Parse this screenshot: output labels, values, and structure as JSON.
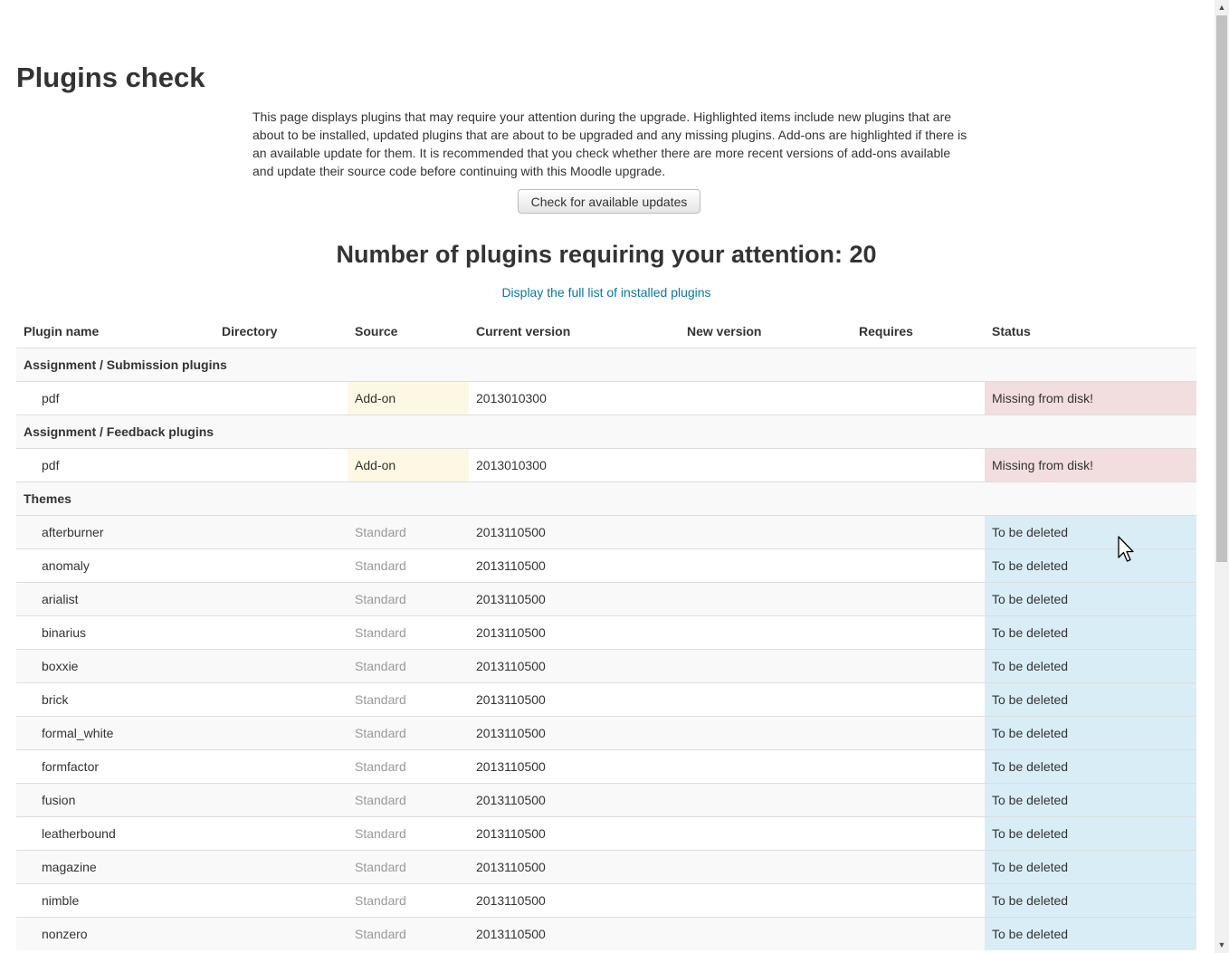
{
  "page": {
    "title": "Plugins check",
    "intro": "This page displays plugins that may require your attention during the upgrade. Highlighted items include new plugins that are about to be installed, updated plugins that are about to be upgraded and any missing plugins. Add-ons are highlighted if there is an available update for them. It is recommended that you check whether there are more recent versions of add-ons available and update their source code before continuing with this Moodle upgrade.",
    "check_button": "Check for available updates",
    "summary": "Number of plugins requiring your attention: 20",
    "full_list_link": "Display the full list of installed plugins"
  },
  "table": {
    "headers": [
      "Plugin name",
      "Directory",
      "Source",
      "Current version",
      "New version",
      "Requires",
      "Status"
    ],
    "rows": [
      {
        "type": "group",
        "name": "Assignment / Submission plugins"
      },
      {
        "type": "plugin",
        "name": "pdf",
        "source": "Add-on",
        "current": "2013010300",
        "status": "Missing from disk!"
      },
      {
        "type": "group",
        "name": "Assignment / Feedback plugins"
      },
      {
        "type": "plugin",
        "name": "pdf",
        "source": "Add-on",
        "current": "2013010300",
        "status": "Missing from disk!"
      },
      {
        "type": "group",
        "name": "Themes"
      },
      {
        "type": "plugin",
        "name": "afterburner",
        "source": "Standard",
        "current": "2013110500",
        "status": "To be deleted"
      },
      {
        "type": "plugin",
        "name": "anomaly",
        "source": "Standard",
        "current": "2013110500",
        "status": "To be deleted"
      },
      {
        "type": "plugin",
        "name": "arialist",
        "source": "Standard",
        "current": "2013110500",
        "status": "To be deleted"
      },
      {
        "type": "plugin",
        "name": "binarius",
        "source": "Standard",
        "current": "2013110500",
        "status": "To be deleted"
      },
      {
        "type": "plugin",
        "name": "boxxie",
        "source": "Standard",
        "current": "2013110500",
        "status": "To be deleted"
      },
      {
        "type": "plugin",
        "name": "brick",
        "source": "Standard",
        "current": "2013110500",
        "status": "To be deleted"
      },
      {
        "type": "plugin",
        "name": "formal_white",
        "source": "Standard",
        "current": "2013110500",
        "status": "To be deleted"
      },
      {
        "type": "plugin",
        "name": "formfactor",
        "source": "Standard",
        "current": "2013110500",
        "status": "To be deleted"
      },
      {
        "type": "plugin",
        "name": "fusion",
        "source": "Standard",
        "current": "2013110500",
        "status": "To be deleted"
      },
      {
        "type": "plugin",
        "name": "leatherbound",
        "source": "Standard",
        "current": "2013110500",
        "status": "To be deleted"
      },
      {
        "type": "plugin",
        "name": "magazine",
        "source": "Standard",
        "current": "2013110500",
        "status": "To be deleted"
      },
      {
        "type": "plugin",
        "name": "nimble",
        "source": "Standard",
        "current": "2013110500",
        "status": "To be deleted"
      },
      {
        "type": "plugin",
        "name": "nonzero",
        "source": "Standard",
        "current": "2013110500",
        "status": "To be deleted"
      }
    ]
  },
  "icons": {
    "scroll_up": "scroll-up-arrow-icon",
    "scroll_down": "scroll-down-arrow-icon",
    "cursor": "mouse-pointer-icon"
  },
  "colors": {
    "link": "#0a76a5",
    "addon_bg": "#fcf8e3",
    "missing_bg": "#f2dede",
    "delete_bg": "#d9edf7"
  }
}
